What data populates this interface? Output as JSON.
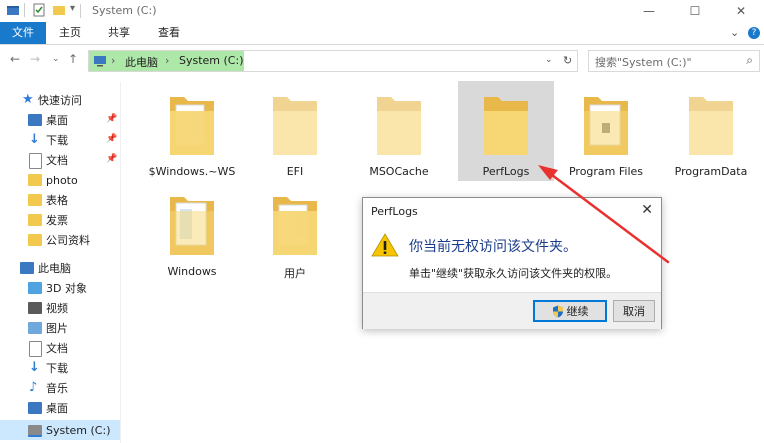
{
  "window": {
    "title": "System (C:)",
    "controls": [
      "minimize",
      "maximize",
      "close"
    ]
  },
  "ribbon": {
    "tabs": [
      {
        "label": "文件",
        "active": true
      },
      {
        "label": "主页",
        "active": false
      },
      {
        "label": "共享",
        "active": false
      },
      {
        "label": "查看",
        "active": false
      }
    ]
  },
  "address": {
    "crumbs": [
      "此电脑",
      "System (C:)"
    ],
    "search_placeholder": "搜索\"System (C:)\""
  },
  "sidebar": {
    "quick_access": "快速访问",
    "pinned": [
      {
        "label": "桌面",
        "icon": "desktop-icon",
        "pinned": true
      },
      {
        "label": "下载",
        "icon": "download-icon",
        "pinned": true
      },
      {
        "label": "文档",
        "icon": "document-icon",
        "pinned": true
      },
      {
        "label": "photo",
        "icon": "folder-icon",
        "pinned": false
      },
      {
        "label": "表格",
        "icon": "folder-icon",
        "pinned": false
      },
      {
        "label": "发票",
        "icon": "folder-icon",
        "pinned": false
      },
      {
        "label": "公司资料",
        "icon": "folder-icon",
        "pinned": false
      }
    ],
    "this_pc": "此电脑",
    "pc_items": [
      {
        "label": "3D 对象",
        "icon": "3d-objects-icon"
      },
      {
        "label": "视频",
        "icon": "video-icon"
      },
      {
        "label": "图片",
        "icon": "picture-icon"
      },
      {
        "label": "文档",
        "icon": "document-icon"
      },
      {
        "label": "下载",
        "icon": "download-icon"
      },
      {
        "label": "音乐",
        "icon": "music-icon"
      },
      {
        "label": "桌面",
        "icon": "desktop-icon"
      },
      {
        "label": "System (C:)",
        "icon": "drive-icon",
        "selected": true
      }
    ]
  },
  "folders": [
    {
      "name": "$Windows.~WS",
      "faded": false,
      "selected": false
    },
    {
      "name": "EFI",
      "faded": true,
      "selected": false
    },
    {
      "name": "MSOCache",
      "faded": true,
      "selected": false
    },
    {
      "name": "PerfLogs",
      "faded": false,
      "selected": true
    },
    {
      "name": "Program Files",
      "faded": false,
      "selected": false
    },
    {
      "name": "ProgramData",
      "faded": true,
      "selected": false
    },
    {
      "name": "Windows",
      "faded": false,
      "selected": false
    },
    {
      "name": "用户",
      "faded": false,
      "selected": false
    }
  ],
  "dialog": {
    "title": "PerfLogs",
    "message": "你当前无权访问该文件夹。",
    "detail": "单击\"继续\"获取永久访问该文件夹的权限。",
    "continue_label": "继续",
    "cancel_label": "取消"
  },
  "colors": {
    "accent": "#1979ca",
    "address_highlight": "#aee8a9",
    "folder": "#f7d774",
    "arrow": "#e8322f",
    "selected": "#d9d9d9"
  }
}
